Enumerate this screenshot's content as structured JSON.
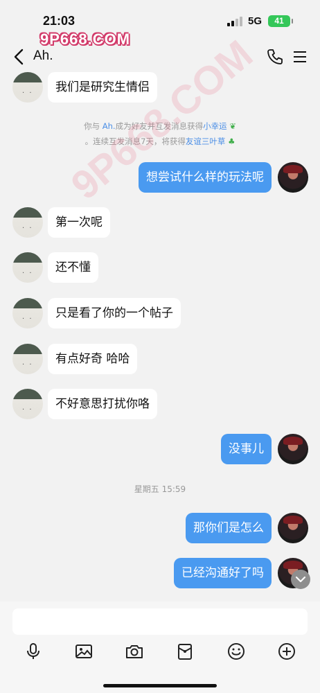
{
  "status_bar": {
    "time": "21:03",
    "network": "5G",
    "battery": "41",
    "watermark": "9P668.COM"
  },
  "header": {
    "title": "Ah."
  },
  "messages": [
    {
      "side": "left",
      "text": "我们是研究生情侣"
    },
    {
      "side": "right",
      "text": "想尝试什么样的玩法呢"
    },
    {
      "side": "left",
      "text": "第一次呢"
    },
    {
      "side": "left",
      "text": "还不懂"
    },
    {
      "side": "left",
      "text": "只是看了你的一个帖子"
    },
    {
      "side": "left",
      "text": "有点好奇 哈哈"
    },
    {
      "side": "left",
      "text": "不好意思打扰你咯"
    },
    {
      "side": "right",
      "text": "没事儿"
    },
    {
      "side": "right",
      "text": "那你们是怎么"
    },
    {
      "side": "right",
      "text": "已经沟通好了吗"
    }
  ],
  "system_notice": {
    "line1_prefix": "你与",
    "line1_name": "Ah.",
    "line1_middle": "成为好友并互发消息获得",
    "line1_reward": "小幸运",
    "line2_prefix": "。连续互发消息7天，将获得",
    "line2_reward": "友谊三叶草"
  },
  "timestamp": "星期五 15:59",
  "watermark_diagonal": "9P668.COM",
  "toolbar_icons": [
    "microphone-icon",
    "image-icon",
    "camera-icon",
    "red-packet-icon",
    "emoji-icon",
    "plus-icon"
  ],
  "colors": {
    "bubble_right": "#4a9af0",
    "bubble_left": "#ffffff",
    "background": "#f2f2f2",
    "accent_link": "#4a8ee6"
  }
}
